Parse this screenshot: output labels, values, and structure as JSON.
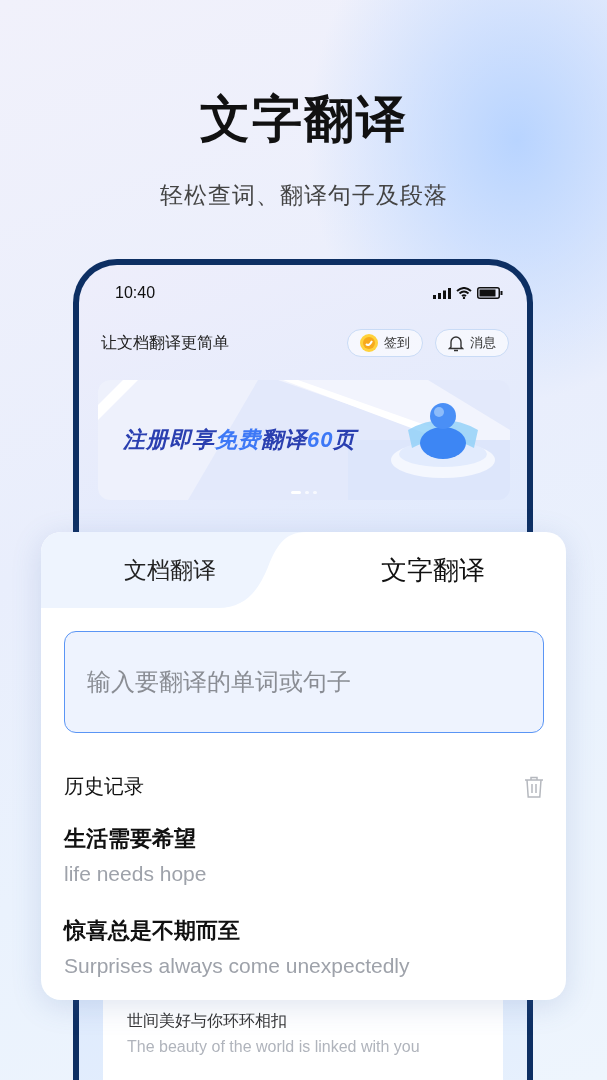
{
  "headline": "文字翻译",
  "subtitle": "轻松查词、翻译句子及段落",
  "phone": {
    "status_bar": {
      "time": "10:40"
    },
    "header": {
      "title": "让文档翻译更简单",
      "buttons": [
        {
          "kind": "checkin",
          "label": "签到"
        },
        {
          "kind": "messages",
          "label": "消息"
        }
      ]
    },
    "banner": {
      "segments": [
        {
          "text": "注册即享",
          "highlight": false
        },
        {
          "text": "免费",
          "highlight": true
        },
        {
          "text": "翻译",
          "highlight": false
        },
        {
          "text": "60",
          "highlight": true
        },
        {
          "text": "页",
          "highlight": false
        }
      ],
      "dots": [
        {
          "selected": true
        },
        {
          "selected": false
        },
        {
          "selected": false
        }
      ]
    },
    "lower_item": {
      "source": "世间美好与你环环相扣",
      "translation": "The beauty of the world is linked with you"
    }
  },
  "card": {
    "tabs": [
      {
        "label": "文档翻译",
        "selected": false
      },
      {
        "label": "文字翻译",
        "selected": true
      }
    ],
    "input": {
      "placeholder": "输入要翻译的单词或句子"
    },
    "history": {
      "title": "历史记录",
      "items": [
        {
          "source": "生活需要希望",
          "translation": "life needs hope"
        },
        {
          "source": "惊喜总是不期而至",
          "translation": "Surprises always come unexpectedly"
        }
      ]
    }
  }
}
